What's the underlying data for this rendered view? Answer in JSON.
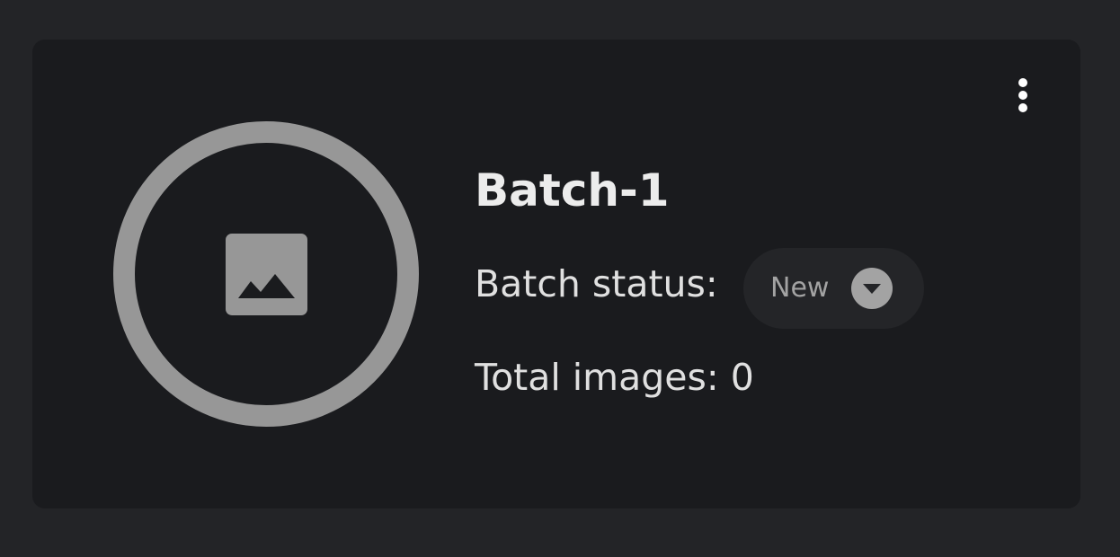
{
  "card": {
    "title": "Batch-1",
    "thumbnail_icon": "image-icon",
    "menu_icon": "more-vertical-icon",
    "status_label": "Batch status:",
    "status_value": "New",
    "status_dropdown_icon": "chevron-down-circle-icon",
    "total_images_label": "Total images: 0"
  },
  "colors": {
    "page_background": "#232427",
    "card_background": "#1a1b1e",
    "thumbnail_gray": "#979797",
    "chip_background": "#242528",
    "text_primary": "#ececec"
  }
}
